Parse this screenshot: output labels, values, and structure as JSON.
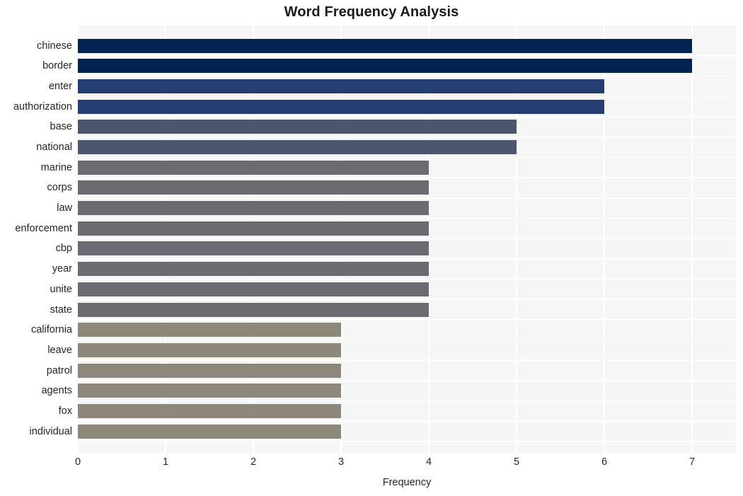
{
  "chart_data": {
    "type": "bar",
    "orientation": "horizontal",
    "title": "Word Frequency Analysis",
    "xlabel": "Frequency",
    "ylabel": "",
    "categories": [
      "chinese",
      "border",
      "enter",
      "authorization",
      "base",
      "national",
      "marine",
      "corps",
      "law",
      "enforcement",
      "cbp",
      "year",
      "unite",
      "state",
      "california",
      "leave",
      "patrol",
      "agents",
      "fox",
      "individual"
    ],
    "values": [
      7,
      7,
      6,
      6,
      5,
      5,
      4,
      4,
      4,
      4,
      4,
      4,
      4,
      4,
      3,
      3,
      3,
      3,
      3,
      3
    ],
    "bar_colors": [
      "#02224f",
      "#02224f",
      "#253d70",
      "#253d70",
      "#4d566f",
      "#4d566f",
      "#6b6c72",
      "#6b6c72",
      "#6b6c72",
      "#6b6c72",
      "#6b6c72",
      "#6b6c72",
      "#6b6c72",
      "#6b6c72",
      "#8e887a",
      "#8e887a",
      "#8e887a",
      "#8e887a",
      "#8e887a",
      "#8e887a"
    ],
    "xticks": [
      0,
      1,
      2,
      3,
      4,
      5,
      6,
      7
    ],
    "xtick_labels": [
      "0",
      "1",
      "2",
      "3",
      "4",
      "5",
      "6",
      "7"
    ],
    "xlim": [
      0,
      7.5
    ],
    "grid": true,
    "grid_color": "#ffffff",
    "plot_background": "#f6f6f6",
    "figure_background": "#ffffff",
    "legend": null
  }
}
